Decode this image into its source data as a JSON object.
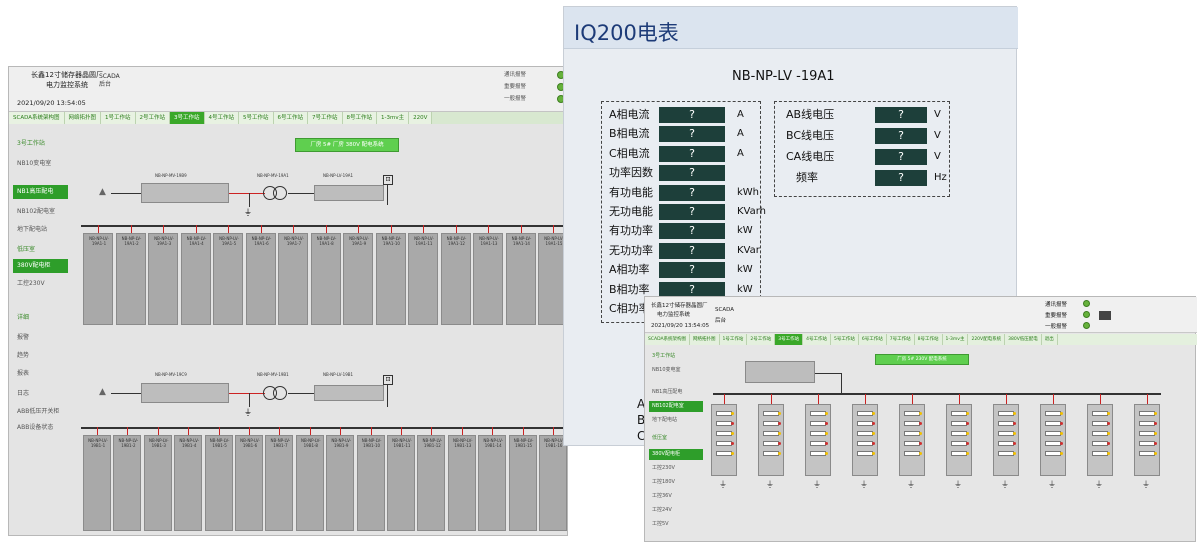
{
  "left_window": {
    "title_line1": "长鑫12寸储存器晶圆厂",
    "title_line2": "电力监控系统",
    "time": "2021/09/20   13:54:05",
    "scada": "SCADA",
    "scada_sub": "后台",
    "status": [
      "通讯报警",
      "重要报警",
      "一般报警"
    ],
    "tabs": [
      "SCADA系统架构图",
      "网络拓扑图",
      "1号工作站",
      "2号工作站",
      "3号工作站",
      "4号工作站",
      "5号工作站",
      "6号工作站",
      "7号工作站",
      "8号工作站",
      "1-3mv主",
      "220V"
    ],
    "active_tab": 4,
    "side": [
      "3号工作站",
      "NB10变电室",
      "NB1高压配电",
      "NB102配电室",
      "地下配电站",
      "低压室",
      "380V配电柜",
      "工控230V",
      "详细",
      "报警",
      "趋势",
      "报表",
      "日志",
      "ABB低压开关柜",
      "ABB设备状态"
    ],
    "center_button": "厂房 5# 厂房 380V 配电系统",
    "feeders_top": [
      "NB-NP-LV-19A1-1",
      "NB-NP-LV-19A1-2",
      "NB-NP-LV-19A1-3",
      "NB-NP-LV-19A1-4",
      "NB-NP-LV-19A1-5",
      "NB-NP-LV-19A1-6",
      "NB-NP-LV-19A1-7",
      "NB-NP-LV-19A1-8",
      "NB-NP-LV-19A1-9",
      "NB-NP-LV-19A1-10",
      "NB-NP-LV-19A1-11",
      "NB-NP-LV-19A1-12",
      "NB-NP-LV-19A1-13",
      "NB-NP-LV-19A1-14",
      "NB-NP-LV-19A1-15"
    ],
    "feeders_bottom": [
      "NB-NP-LV-19B1-1",
      "NB-NP-LV-19B1-2",
      "NB-NP-LV-19B1-3",
      "NB-NP-LV-19B1-4",
      "NB-NP-LV-19B1-5",
      "NB-NP-LV-19B1-6",
      "NB-NP-LV-19B1-7",
      "NB-NP-LV-19B1-8",
      "NB-NP-LV-19B1-9",
      "NB-NP-LV-19B1-10",
      "NB-NP-LV-19B1-11",
      "NB-NP-LV-19B1-12",
      "NB-NP-LV-19B1-13",
      "NB-NP-LV-19B1-14",
      "NB-NP-LV-19B1-15",
      "NB-NP-LV-19B1-16"
    ],
    "top_cab_label": "NB-NP-MV-19B9",
    "top_tx_label": "NB-NP-MV-19A1",
    "top_lv_label": "NB-NP-LV-19A1",
    "bot_cab_label": "NB-NP-MV-19C9",
    "bot_tx_label": "NB-NP-MV-19B1",
    "bot_lv_label": "NB-NP-LV-19B1"
  },
  "meter": {
    "title": "IQ200电表",
    "device": "NB-NP-LV -19A1",
    "left_rows": [
      {
        "label": "A相电流",
        "value": "?",
        "unit": "A"
      },
      {
        "label": "B相电流",
        "value": "?",
        "unit": "A"
      },
      {
        "label": "C相电流",
        "value": "?",
        "unit": "A"
      },
      {
        "label": "功率因数",
        "value": "?",
        "unit": ""
      },
      {
        "label": "有功电能",
        "value": "?",
        "unit": "kWh"
      },
      {
        "label": "无功电能",
        "value": "?",
        "unit": "KVarh"
      },
      {
        "label": "有功功率",
        "value": "?",
        "unit": "kW"
      },
      {
        "label": "无功功率",
        "value": "?",
        "unit": "KVar"
      },
      {
        "label": "A相功率",
        "value": "?",
        "unit": "kW"
      },
      {
        "label": "B相功率",
        "value": "?",
        "unit": "kW"
      },
      {
        "label": "C相功率",
        "value": "?",
        "unit": ""
      }
    ],
    "right_rows": [
      {
        "label": "AB线电压",
        "value": "?",
        "unit": "V"
      },
      {
        "label": "BC线电压",
        "value": "?",
        "unit": "V"
      },
      {
        "label": "CA线电压",
        "value": "?",
        "unit": "V"
      },
      {
        "label": "频率",
        "value": "?",
        "unit": "Hz"
      }
    ],
    "peek": [
      "A",
      "B",
      "C"
    ]
  },
  "right_window": {
    "title_line1": "长鑫12寸储存器晶圆厂",
    "title_line2": "电力监控系统",
    "time": "2021/09/20   13:54:05",
    "scada": "SCADA",
    "scada_sub": "后台",
    "status": [
      "通讯报警",
      "重要报警",
      "一般报警"
    ],
    "tabs": [
      "SCADA系统架构图",
      "网络拓扑图",
      "1号工作站",
      "2号工作站",
      "3号工作站",
      "4号工作站",
      "5号工作站",
      "6号工作站",
      "7号工作站",
      "8号工作站",
      "1-3mv主",
      "220V配电系统",
      "380V低压配电",
      "退出"
    ],
    "active_tab": 4,
    "side": [
      "3号工作站",
      "NB10变电室",
      "NB1高压配电",
      "NB102配电室",
      "地下配电站",
      "低压室",
      "380V配电柜",
      "工控230V",
      "工控180V",
      "工控36V",
      "工控24V",
      "工控5V"
    ],
    "center_button": "厂房 5# 230V 配电系统"
  }
}
